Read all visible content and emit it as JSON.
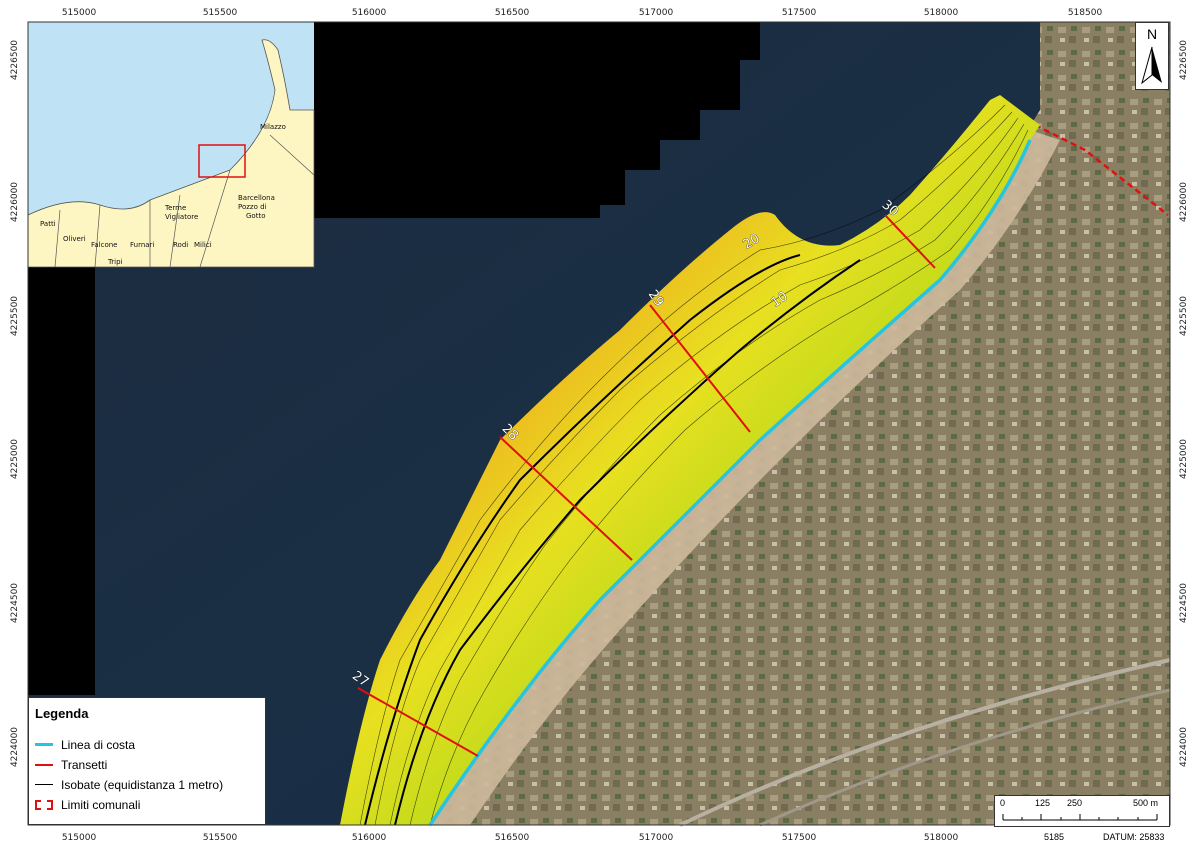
{
  "coords": {
    "x": [
      "515000",
      "515500",
      "516000",
      "516500",
      "517000",
      "517500",
      "518000",
      "518500"
    ],
    "y": [
      "4226500",
      "4226000",
      "4225500",
      "4225000",
      "4224500",
      "4224000"
    ]
  },
  "inset": {
    "places": [
      "Milazzo",
      "Terme\nVigliatore",
      "Barcellona\nPozzo di\nGotto",
      "Patti",
      "Oliveri",
      "Falcone",
      "Furnari",
      "Rodi",
      "Milici",
      "Tripi"
    ]
  },
  "isobath_labels": [
    "20",
    "10"
  ],
  "transects": [
    "27",
    "28",
    "29",
    "30"
  ],
  "legend": {
    "title": "Legenda",
    "items": [
      {
        "label": "Linea di costa",
        "symbol": "coast"
      },
      {
        "label": "Transetti",
        "symbol": "transect"
      },
      {
        "label": "Isobate (equidistanza 1 metro)",
        "symbol": "isobath"
      },
      {
        "label": "Limiti comunali",
        "symbol": "limits"
      }
    ]
  },
  "north": {
    "label": "N"
  },
  "scale": {
    "ticks": [
      "0",
      "125",
      "250",
      "500 m"
    ]
  },
  "footer": {
    "code": "5185",
    "datum": "DATUM: 25833"
  },
  "colors": {
    "coast": "#27c4e0",
    "transect": "#e01010",
    "deep": "#e8551a",
    "shallow": "#1a9a1a",
    "sea": "#1b2a3d"
  }
}
